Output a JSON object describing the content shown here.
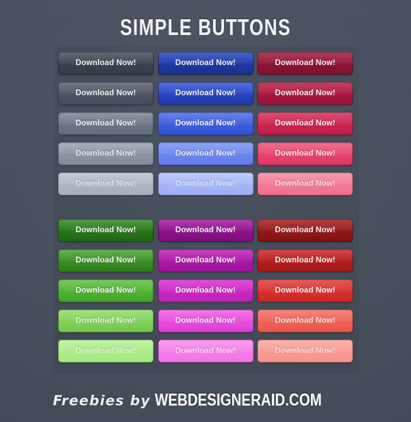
{
  "page": {
    "title": "SIMPLE BUTTONS",
    "background_color": "#474f5e",
    "plate_color": "rgba(0,0,0,0.055)"
  },
  "footer": {
    "script_text": "Freebies by",
    "brand_text": "WEBDESIGNERAID.COM"
  },
  "button_label": "Download Now!",
  "groups": [
    {
      "name": "group-neutral-blue-crimson",
      "rows": [
        {
          "name": "row-shade-1",
          "buttons": [
            {
              "name": "button-gray-1",
              "label": "Download Now!",
              "top": "#454d5b",
              "bottom": "#343b47",
              "border": "#2b313b",
              "text_color": "#ffffff",
              "text_opacity": 0.95
            },
            {
              "name": "button-blue-1",
              "label": "Download Now!",
              "top": "#2545c4",
              "bottom": "#1a2f8c",
              "border": "#152567",
              "text_color": "#ffffff",
              "text_opacity": 0.95
            },
            {
              "name": "button-crimson-1",
              "label": "Download Now!",
              "top": "#a4183c",
              "bottom": "#7c1030",
              "border": "#5e0c24",
              "text_color": "#ffffff",
              "text_opacity": 0.95
            }
          ]
        },
        {
          "name": "row-shade-2",
          "buttons": [
            {
              "name": "button-gray-2",
              "label": "Download Now!",
              "top": "#59616f",
              "bottom": "#434a58",
              "border": "#363d48",
              "text_color": "#ffffff",
              "text_opacity": 0.95
            },
            {
              "name": "button-blue-2",
              "label": "Download Now!",
              "top": "#3154de",
              "bottom": "#2039a8",
              "border": "#1a2f80",
              "text_color": "#ffffff",
              "text_opacity": 0.95
            },
            {
              "name": "button-crimson-2",
              "label": "Download Now!",
              "top": "#bf1c47",
              "bottom": "#951638",
              "border": "#73112b",
              "text_color": "#ffffff",
              "text_opacity": 0.95
            }
          ]
        },
        {
          "name": "row-shade-3",
          "buttons": [
            {
              "name": "button-gray-3",
              "label": "Download Now!",
              "top": "#7a8393",
              "bottom": "#626b79",
              "border": "#4e5664",
              "text_color": "#ffffff",
              "text_opacity": 0.92
            },
            {
              "name": "button-blue-3",
              "label": "Download Now!",
              "top": "#4a6bee",
              "bottom": "#3351d2",
              "border": "#2a43ab",
              "text_color": "#ffffff",
              "text_opacity": 0.95
            },
            {
              "name": "button-crimson-3",
              "label": "Download Now!",
              "top": "#dd2a57",
              "bottom": "#bb1f48",
              "border": "#94173a",
              "text_color": "#ffffff",
              "text_opacity": 0.95
            }
          ]
        },
        {
          "name": "row-shade-4",
          "buttons": [
            {
              "name": "button-gray-4",
              "label": "Download Now!",
              "top": "#99a1ae",
              "bottom": "#828b99",
              "border": "#6c7482",
              "text_color": "#ffffff",
              "text_opacity": 0.8
            },
            {
              "name": "button-blue-4",
              "label": "Download Now!",
              "top": "#7b93f4",
              "bottom": "#5f7aea",
              "border": "#4e65c4",
              "text_color": "#ffffff",
              "text_opacity": 0.82
            },
            {
              "name": "button-crimson-4",
              "label": "Download Now!",
              "top": "#ef5377",
              "bottom": "#e03763",
              "border": "#b82c50",
              "text_color": "#ffffff",
              "text_opacity": 0.88
            }
          ]
        },
        {
          "name": "row-shade-5",
          "buttons": [
            {
              "name": "button-gray-5",
              "label": "Download Now!",
              "top": "#b9c0cb",
              "bottom": "#a6aeba",
              "border": "#8d95a1",
              "text_color": "#ffffff",
              "text_opacity": 0.62
            },
            {
              "name": "button-blue-5",
              "label": "Download Now!",
              "top": "#b3c0f8",
              "bottom": "#9dadf3",
              "border": "#8492ce",
              "text_color": "#ffffff",
              "text_opacity": 0.62
            },
            {
              "name": "button-crimson-5",
              "label": "Download Now!",
              "top": "#f5899f",
              "bottom": "#ef6f8c",
              "border": "#c75d75",
              "text_color": "#ffffff",
              "text_opacity": 0.72
            }
          ]
        }
      ]
    },
    {
      "name": "group-green-magenta-red",
      "rows": [
        {
          "name": "row-shade-1",
          "buttons": [
            {
              "name": "button-green-1",
              "label": "Download Now!",
              "top": "#2f8a1f",
              "bottom": "#1f6412",
              "border": "#18500e",
              "text_color": "#ffffff",
              "text_opacity": 0.95
            },
            {
              "name": "button-magenta-1",
              "label": "Download Now!",
              "top": "#a4169f",
              "bottom": "#790e78",
              "border": "#5d0b5c",
              "text_color": "#ffffff",
              "text_opacity": 0.95
            },
            {
              "name": "button-red-1",
              "label": "Download Now!",
              "top": "#a81d1d",
              "bottom": "#7d1212",
              "border": "#610e0e",
              "text_color": "#ffffff",
              "text_opacity": 0.95
            }
          ]
        },
        {
          "name": "row-shade-2",
          "buttons": [
            {
              "name": "button-green-2",
              "label": "Download Now!",
              "top": "#45a52b",
              "bottom": "#2e7d1b",
              "border": "#256515",
              "text_color": "#ffffff",
              "text_opacity": 0.95
            },
            {
              "name": "button-magenta-2",
              "label": "Download Now!",
              "top": "#c21cbc",
              "bottom": "#9a1496",
              "border": "#771073",
              "text_color": "#ffffff",
              "text_opacity": 0.95
            },
            {
              "name": "button-red-2",
              "label": "Download Now!",
              "top": "#cc2323",
              "bottom": "#a41919",
              "border": "#801313",
              "text_color": "#ffffff",
              "text_opacity": 0.95
            }
          ]
        },
        {
          "name": "row-shade-3",
          "buttons": [
            {
              "name": "button-green-3",
              "label": "Download Now!",
              "top": "#5cc23b",
              "bottom": "#44a428",
              "border": "#36851f",
              "text_color": "#ffffff",
              "text_opacity": 0.95
            },
            {
              "name": "button-magenta-3",
              "label": "Download Now!",
              "top": "#dc2fd4",
              "bottom": "#bb21b4",
              "border": "#931a8e",
              "text_color": "#ffffff",
              "text_opacity": 0.95
            },
            {
              "name": "button-red-3",
              "label": "Download Now!",
              "top": "#e53a35",
              "bottom": "#cc2824",
              "border": "#a3201d",
              "text_color": "#ffffff",
              "text_opacity": 0.95
            }
          ]
        },
        {
          "name": "row-shade-4",
          "buttons": [
            {
              "name": "button-green-4",
              "label": "Download Now!",
              "top": "#8ddc66",
              "bottom": "#72c84c",
              "border": "#5da33f",
              "text_color": "#ffffff",
              "text_opacity": 0.8
            },
            {
              "name": "button-magenta-4",
              "label": "Download Now!",
              "top": "#ef5ce6",
              "bottom": "#e13dd6",
              "border": "#b832ae",
              "text_color": "#ffffff",
              "text_opacity": 0.85
            },
            {
              "name": "button-red-4",
              "label": "Download Now!",
              "top": "#f56e63",
              "bottom": "#ec5549",
              "border": "#c0463c",
              "text_color": "#ffffff",
              "text_opacity": 0.82
            }
          ]
        },
        {
          "name": "row-shade-5",
          "buttons": [
            {
              "name": "button-green-5",
              "label": "Download Now!",
              "top": "#b6f294",
              "bottom": "#a1e87d",
              "border": "#85bf68",
              "text_color": "#ffffff",
              "text_opacity": 0.62
            },
            {
              "name": "button-magenta-5",
              "label": "Download Now!",
              "top": "#f88bef",
              "bottom": "#f272e8",
              "border": "#c75ebf",
              "text_color": "#ffffff",
              "text_opacity": 0.68
            },
            {
              "name": "button-red-5",
              "label": "Download Now!",
              "top": "#faa79c",
              "bottom": "#f59389",
              "border": "#c97a72",
              "text_color": "#ffffff",
              "text_opacity": 0.62
            }
          ]
        }
      ]
    }
  ]
}
